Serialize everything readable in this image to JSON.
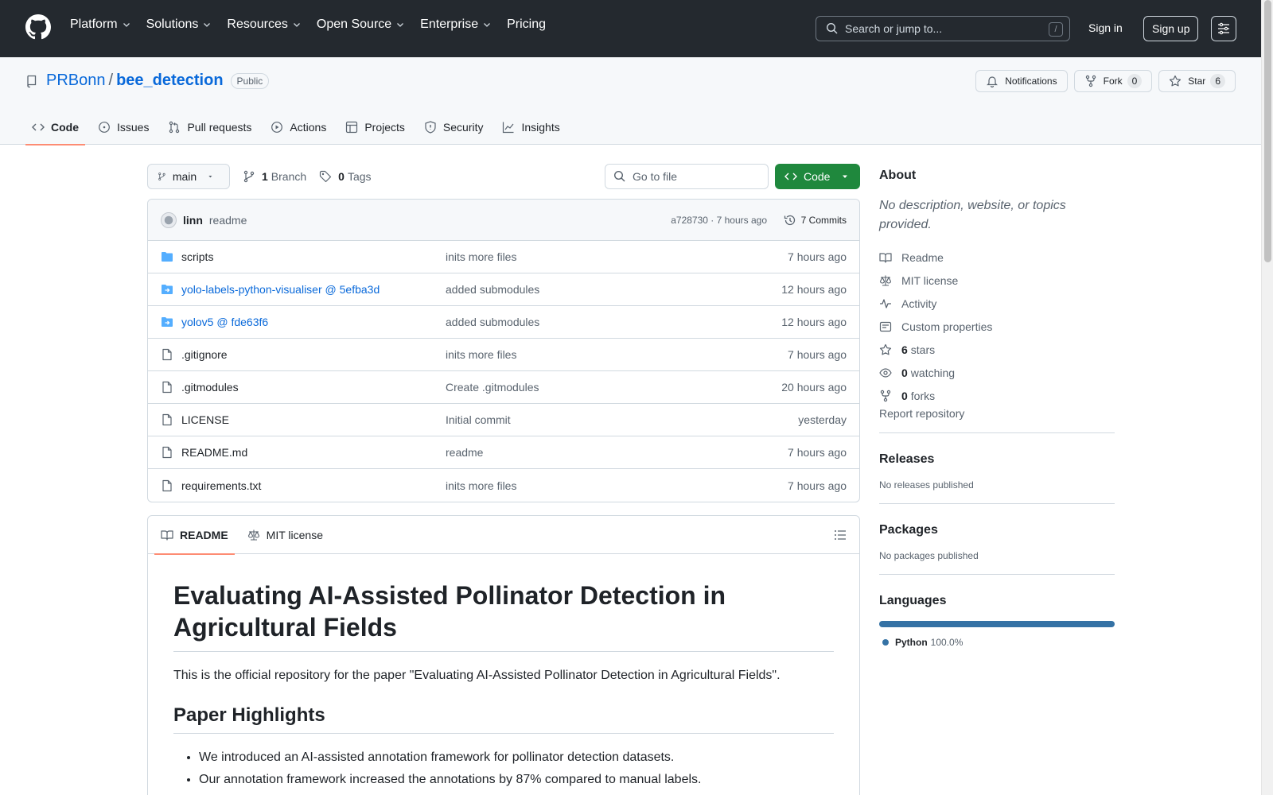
{
  "header": {
    "nav": [
      "Platform",
      "Solutions",
      "Resources",
      "Open Source",
      "Enterprise",
      "Pricing"
    ],
    "search_placeholder": "Search or jump to...",
    "search_shortcut": "/",
    "sign_in": "Sign in",
    "sign_up": "Sign up"
  },
  "repo": {
    "owner": "PRBonn",
    "separator": "/",
    "name": "bee_detection",
    "visibility": "Public",
    "notifications": "Notifications",
    "fork_label": "Fork",
    "fork_count": "0",
    "star_label": "Star",
    "star_count": "6"
  },
  "tabs": [
    "Code",
    "Issues",
    "Pull requests",
    "Actions",
    "Projects",
    "Security",
    "Insights"
  ],
  "filebar": {
    "branch": "main",
    "branch_count": "1",
    "branch_label": "Branch",
    "tag_count": "0",
    "tag_label": "Tags",
    "goto_placeholder": "Go to file",
    "code_button": "Code"
  },
  "commit": {
    "author": "linn",
    "message": "readme",
    "hash_time": "a728730 · 7 hours ago",
    "commits": "7 Commits"
  },
  "files": [
    {
      "name": "scripts",
      "type": "folder",
      "message": "inits more files",
      "time": "7 hours ago"
    },
    {
      "name": "yolo-labels-python-visualiser @ 5efba3d",
      "type": "submodule",
      "message": "added submodules",
      "time": "12 hours ago"
    },
    {
      "name": "yolov5 @ fde63f6",
      "type": "submodule",
      "message": "added submodules",
      "time": "12 hours ago"
    },
    {
      "name": ".gitignore",
      "type": "file",
      "message": "inits more files",
      "time": "7 hours ago"
    },
    {
      "name": ".gitmodules",
      "type": "file",
      "message": "Create .gitmodules",
      "time": "20 hours ago"
    },
    {
      "name": "LICENSE",
      "type": "file",
      "message": "Initial commit",
      "time": "yesterday"
    },
    {
      "name": "README.md",
      "type": "file",
      "message": "readme",
      "time": "7 hours ago"
    },
    {
      "name": "requirements.txt",
      "type": "file",
      "message": "inits more files",
      "time": "7 hours ago"
    }
  ],
  "readme": {
    "tab_readme": "README",
    "tab_license": "MIT license",
    "title": "Evaluating AI-Assisted Pollinator Detection in Agricultural Fields",
    "intro": "This is the official repository for the paper \"Evaluating AI-Assisted Pollinator Detection in Agricultural Fields\".",
    "highlights_heading": "Paper Highlights",
    "highlights": [
      "We introduced an AI-assisted annotation framework for pollinator detection datasets.",
      "Our annotation framework increased the annotations by 87% compared to manual labels."
    ]
  },
  "sidebar": {
    "about_heading": "About",
    "about_desc": "No description, website, or topics provided.",
    "links": [
      {
        "icon": "book-icon",
        "label": "Readme",
        "count": ""
      },
      {
        "icon": "law-icon",
        "label": "MIT license",
        "count": ""
      },
      {
        "icon": "pulse-icon",
        "label": "Activity",
        "count": ""
      },
      {
        "icon": "note-icon",
        "label": "Custom properties",
        "count": ""
      },
      {
        "icon": "star-icon",
        "label": "stars",
        "count": "6"
      },
      {
        "icon": "eye-icon",
        "label": "watching",
        "count": "0"
      },
      {
        "icon": "fork-icon",
        "label": "forks",
        "count": "0"
      }
    ],
    "report": "Report repository",
    "releases_heading": "Releases",
    "releases_sub": "No releases published",
    "packages_heading": "Packages",
    "packages_sub": "No packages published",
    "languages_heading": "Languages",
    "language": {
      "name": "Python",
      "percent": "100.0%",
      "color": "#3572A5"
    }
  }
}
